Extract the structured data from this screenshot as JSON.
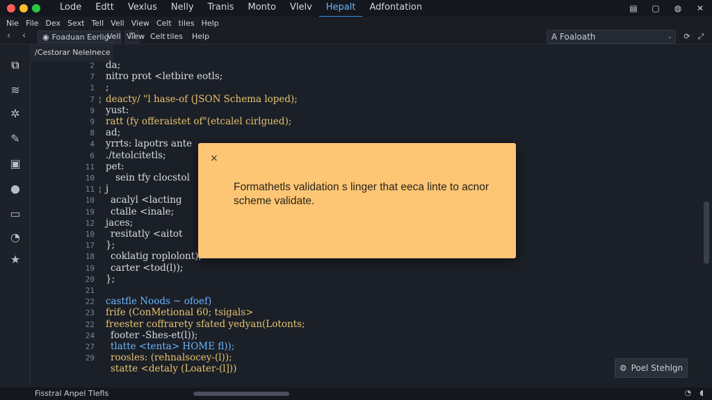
{
  "titlebar": {
    "menu": [
      "Lode",
      "Edtt",
      "Vexlus",
      "Nelly",
      "Tranis",
      "Monto",
      "Vlelv",
      "Hepalt",
      "Adfontation"
    ],
    "active_index": 7,
    "icons": [
      "panel-icon",
      "square-icon",
      "globe-icon",
      "close-icon"
    ]
  },
  "submenu": [
    "Nie",
    "File",
    "Dex",
    "Sext",
    "Tell",
    "Vell",
    "View",
    "Celt",
    "tiles",
    "Help"
  ],
  "toolbar": {
    "tab_select": "Foaduan Eerlig",
    "labels": [
      "Vell",
      "View",
      "Celt",
      "tiles",
      "Help"
    ],
    "search_value": "A Foaloath"
  },
  "activitybar": [
    "files-icon",
    "layers-icon",
    "settings-icon",
    "pen-icon",
    "document-icon",
    "apple-icon",
    "terminal-icon",
    "branch-icon",
    "star-icon"
  ],
  "editor": {
    "tab_label": "/Cestorar Nelelnece",
    "line_numbers": [
      "2",
      "7",
      "1",
      "7",
      "9",
      "9",
      "8",
      "4",
      "6",
      "11",
      "10",
      "11",
      "10",
      "19",
      "12",
      "10",
      "17",
      "18",
      "19",
      "20",
      "21",
      "22",
      "23",
      "22",
      "24",
      "27",
      "29"
    ],
    "lines": [
      {
        "indent": 0,
        "text": "da;"
      },
      {
        "indent": 0,
        "text": "nitro prot <letbire eotls;"
      },
      {
        "indent": 0,
        "text": ";"
      },
      {
        "indent": 0,
        "text": "deacty/ \"l hase-of (JSON Schema loped);"
      },
      {
        "indent": 0,
        "text": "yust:"
      },
      {
        "indent": 0,
        "text": "ratt (fy offeraistet of\"(etcalel cirlgued);"
      },
      {
        "indent": 0,
        "text": "ad;"
      },
      {
        "indent": 0,
        "text": "yrrts: lapotrs ante"
      },
      {
        "indent": 0,
        "text": "./tetolcitetls;"
      },
      {
        "indent": 0,
        "text": "pet:"
      },
      {
        "indent": 2,
        "text": "sein tfy clocstol"
      },
      {
        "indent": 0,
        "text": "j"
      },
      {
        "indent": 1,
        "text": "acalyl <lacting"
      },
      {
        "indent": 1,
        "text": "ctalle <inale;"
      },
      {
        "indent": 0,
        "text": "jaces;"
      },
      {
        "indent": 1,
        "text": "resitatly <aitot"
      },
      {
        "indent": 0,
        "text": "};"
      },
      {
        "indent": 1,
        "text": "coklatig roplolont);"
      },
      {
        "indent": 1,
        "text": "carter <tod(l));"
      },
      {
        "indent": 0,
        "text": "};"
      },
      {
        "indent": 0,
        "text": ""
      },
      {
        "indent": 0,
        "text": "castfle Noods ~ ofoef)"
      },
      {
        "indent": 0,
        "text": "frife (ConMetional 60; tsigals>"
      },
      {
        "indent": 0,
        "text": "freester coffrarety sfated yedyan(Lotonts;"
      },
      {
        "indent": 1,
        "text": "footer -Shes-et(l));"
      },
      {
        "indent": 1,
        "text": "tlatte <tenta> HOME fl));"
      },
      {
        "indent": 1,
        "text": "roosles: (rehnalsocey-(l));"
      },
      {
        "indent": 1,
        "text": "statte <detaly (Loater-(l]))"
      }
    ]
  },
  "modal": {
    "close_glyph": "×",
    "message": "Formathetls validation s linger that eeca linte to acnor scheme validate."
  },
  "float_button": {
    "label": "Poel Stehlgn"
  },
  "statusbar": {
    "label": "Fisstral Anpel Tlefls"
  },
  "colors": {
    "modal_bg": "#fdc675",
    "accent": "#3b8eea",
    "editor_bg": "#1b1f27"
  }
}
